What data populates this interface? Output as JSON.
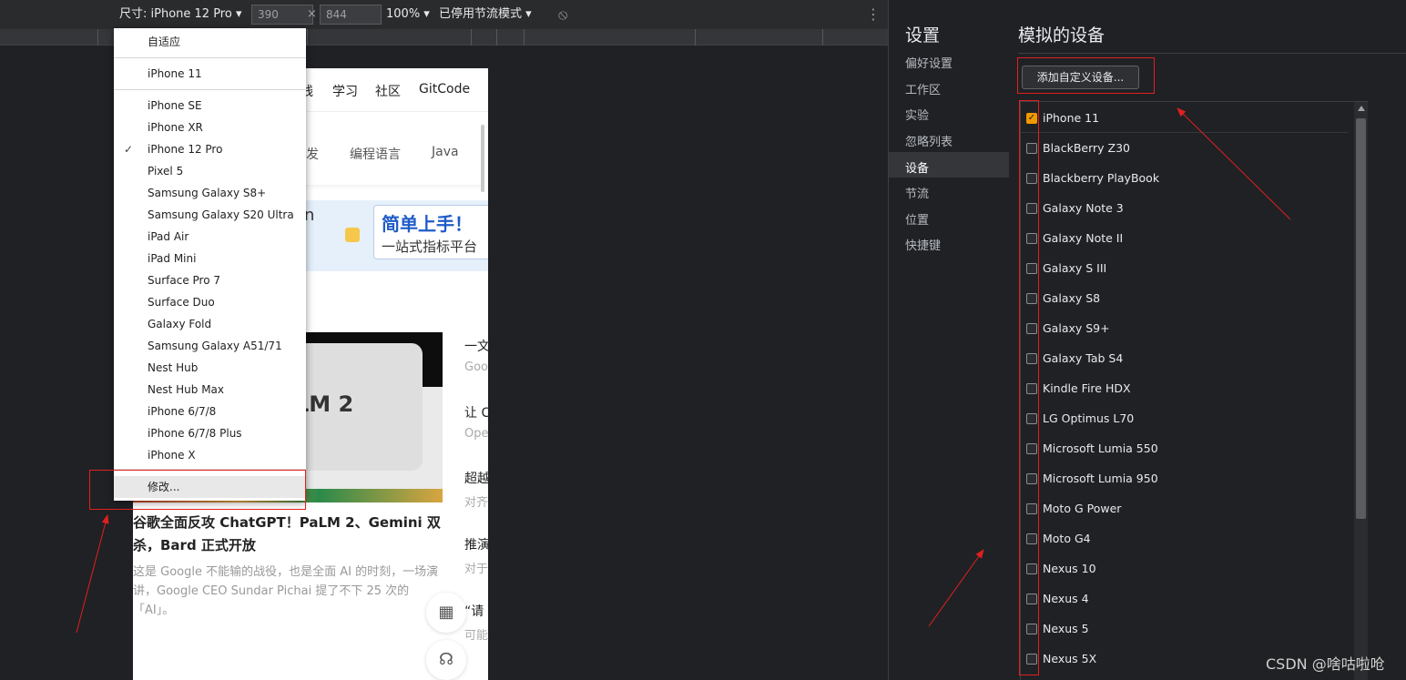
{
  "toolbar": {
    "size_label": "尺寸: iPhone 12 Pro ▾",
    "width": "390",
    "times": "×",
    "height": "844",
    "zoom": "100% ▾",
    "throttle": "已停用节流模式 ▾",
    "rotate_icon": "⦸",
    "more_icon": "⋮"
  },
  "menu": {
    "responsive": "自适应",
    "group1": [
      "iPhone 11"
    ],
    "devices": [
      "iPhone SE",
      "iPhone XR",
      "iPhone 12 Pro",
      "Pixel 5",
      "Samsung Galaxy S8+",
      "Samsung Galaxy S20 Ultra",
      "iPad Air",
      "iPad Mini",
      "Surface Pro 7",
      "Surface Duo",
      "Galaxy Fold",
      "Samsung Galaxy A51/71",
      "Nest Hub",
      "Nest Hub Max",
      "iPhone 6/7/8",
      "iPhone 6/7/8 Plus",
      "iPhone X"
    ],
    "checked": "iPhone 12 Pro",
    "checkmark": "✓",
    "edit": "修改..."
  },
  "page": {
    "nav": [
      "线",
      "学习",
      "社区",
      "GitCode"
    ],
    "subnav": [
      "发",
      "编程语言",
      "Java"
    ],
    "banner_left": "n",
    "banner_title": "简单上手！",
    "banner_sub": "一站式指标平台",
    "lm_text": "LM 2",
    "article_title": "谷歌全面反攻 ChatGPT！PaLM 2、Gemini 双杀，Bard 正式开放",
    "article_desc": "这是 Google 不能输的战役，也是全面 AI 的时刻，一场演讲，Google CEO Sundar Pichai 提了不下 25 次的「AI」。",
    "side_titles": [
      "一文",
      "让 C",
      "超越",
      "推演",
      "“请"
    ],
    "side_descs": [
      "Goo",
      "Ope",
      "对齐",
      "对于",
      "可能"
    ],
    "qr_icon": "▦",
    "headset_icon": "☊"
  },
  "settings": {
    "title": "设置",
    "nav": [
      "偏好设置",
      "工作区",
      "实验",
      "忽略列表",
      "设备",
      "节流",
      "位置",
      "快捷键"
    ],
    "selected_nav": "设备"
  },
  "devices_panel": {
    "title": "模拟的设备",
    "add_button": "添加自定义设备...",
    "items": [
      {
        "name": "iPhone 11",
        "checked": true
      },
      {
        "name": "BlackBerry Z30",
        "checked": false
      },
      {
        "name": "Blackberry PlayBook",
        "checked": false
      },
      {
        "name": "Galaxy Note 3",
        "checked": false
      },
      {
        "name": "Galaxy Note II",
        "checked": false
      },
      {
        "name": "Galaxy S III",
        "checked": false
      },
      {
        "name": "Galaxy S8",
        "checked": false
      },
      {
        "name": "Galaxy S9+",
        "checked": false
      },
      {
        "name": "Galaxy Tab S4",
        "checked": false
      },
      {
        "name": "Kindle Fire HDX",
        "checked": false
      },
      {
        "name": "LG Optimus L70",
        "checked": false
      },
      {
        "name": "Microsoft Lumia 550",
        "checked": false
      },
      {
        "name": "Microsoft Lumia 950",
        "checked": false
      },
      {
        "name": "Moto G Power",
        "checked": false
      },
      {
        "name": "Moto G4",
        "checked": false
      },
      {
        "name": "Nexus 10",
        "checked": false
      },
      {
        "name": "Nexus 4",
        "checked": false
      },
      {
        "name": "Nexus 5",
        "checked": false
      },
      {
        "name": "Nexus 5X",
        "checked": false
      }
    ],
    "check_glyph": "✓"
  },
  "watermark": "CSDN @啥咕啦呛",
  "colors": {
    "annotation": "#e02020",
    "checkbox_on": "#f29900"
  }
}
